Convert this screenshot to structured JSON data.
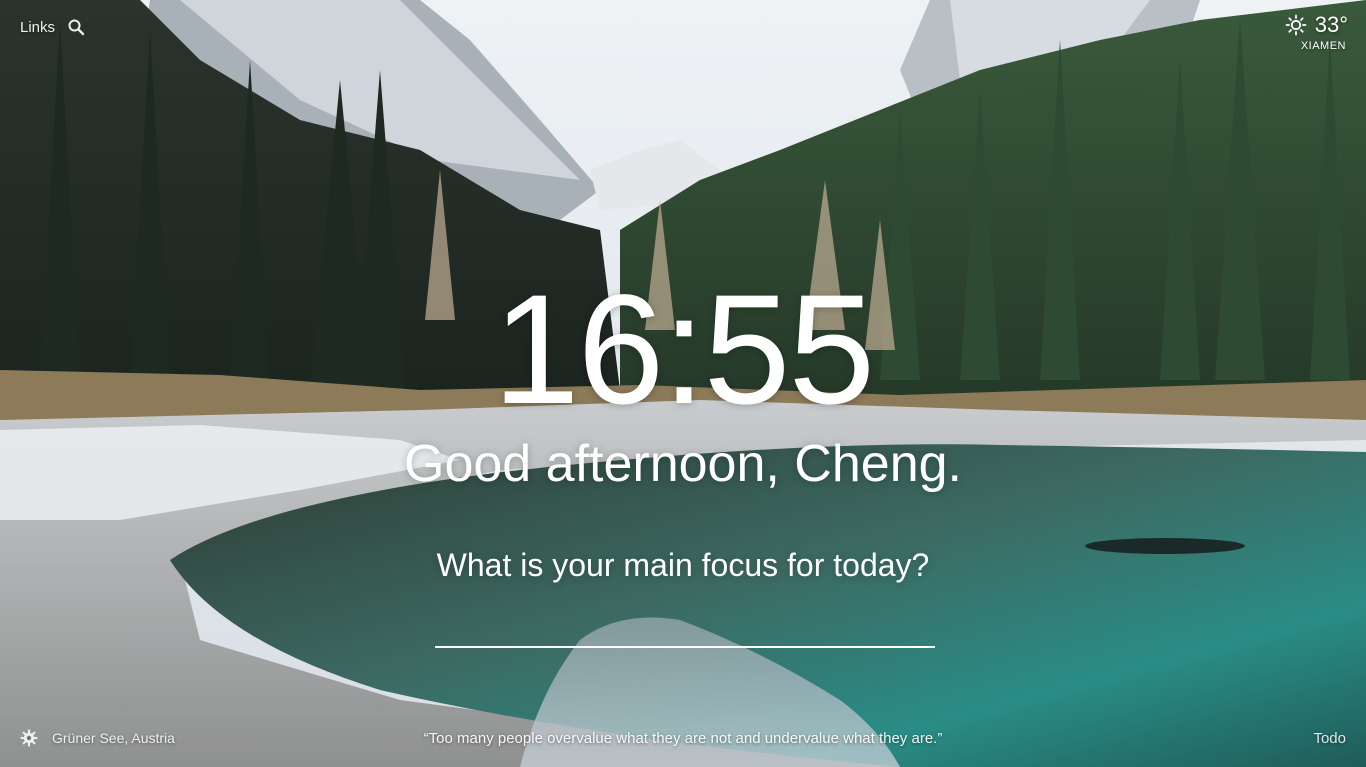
{
  "header": {
    "links_label": "Links",
    "search_icon": "search-icon"
  },
  "weather": {
    "icon": "sun-icon",
    "temperature": "33°",
    "city": "XIAMEN"
  },
  "main": {
    "time": "16:55",
    "greeting": "Good afternoon, Cheng.",
    "focus_prompt": "What is your main focus for today?",
    "focus_value": ""
  },
  "footer": {
    "settings_icon": "gear-icon",
    "location": "Grüner See, Austria",
    "quote": "“Too many people overvalue what they are not and undervalue what they are.”",
    "todo_label": "Todo"
  },
  "background": {
    "scene": "mountain-lake-forest",
    "sky_color": "#dfe6ec",
    "mountain_color": "#b9c1c8",
    "forest_color": "#2a3a2c",
    "water_color": "#2c7b76",
    "shore_color": "#b7b7b5"
  }
}
